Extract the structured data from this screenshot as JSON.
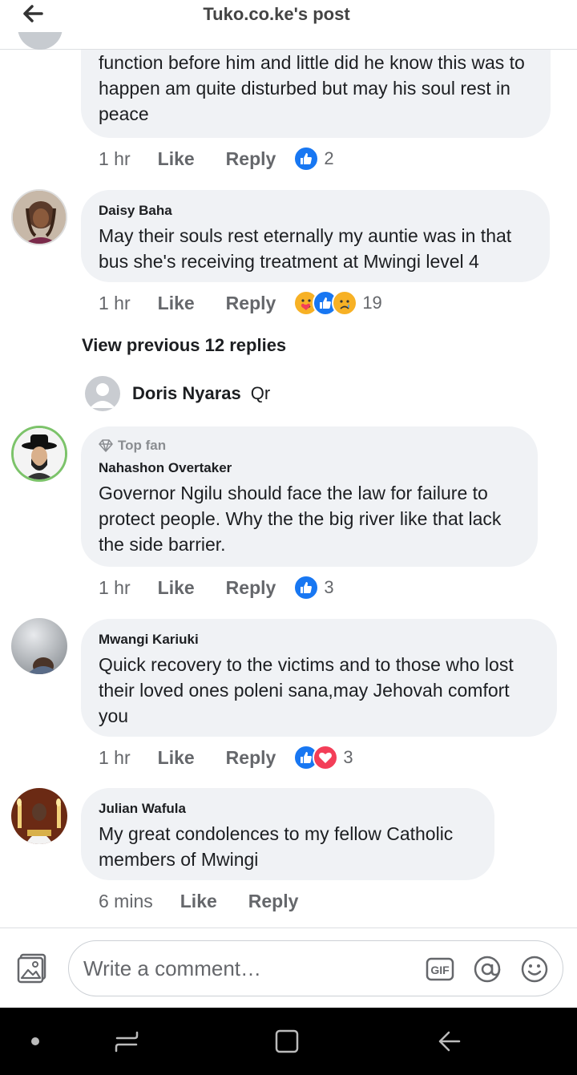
{
  "header": {
    "title": "Tuko.co.ke's post"
  },
  "comments": [
    {
      "author": "",
      "text": "function before him and little did he know this was to happen am quite disturbed but may his soul rest in peace",
      "time": "1 hr",
      "like": "Like",
      "reply": "Reply",
      "reaction_count": "2",
      "reactions": [
        "like-icon"
      ]
    },
    {
      "author": "Daisy Baha",
      "text": "May their souls rest eternally my auntie was in that bus she's receiving treatment at Mwingi level 4",
      "time": "1 hr",
      "like": "Like",
      "reply": "Reply",
      "reaction_count": "19",
      "reactions": [
        "care-icon",
        "like-icon",
        "sad-icon"
      ]
    },
    {
      "author": "Nahashon Overtaker",
      "badge": "Top fan",
      "text": "Governor Ngilu should face the law for failure to protect people. Why the the big river like that lack the side barrier.",
      "time": "1 hr",
      "like": "Like",
      "reply": "Reply",
      "reaction_count": "3",
      "reactions": [
        "like-icon"
      ]
    },
    {
      "author": "Mwangi Kariuki",
      "text": "Quick recovery to the victims and to those who lost their loved ones poleni sana,may Jehovah comfort you",
      "time": "1 hr",
      "like": "Like",
      "reply": "Reply",
      "reaction_count": "3",
      "reactions": [
        "like-icon",
        "love-icon"
      ]
    },
    {
      "author": "Julian Wafula",
      "text": "My great condolences to my fellow Catholic members of Mwingi",
      "time": "6 mins",
      "like": "Like",
      "reply": "Reply"
    }
  ],
  "view_previous": "View previous 12 replies",
  "typing": {
    "name": "Doris Nyaras",
    "text": "Qr"
  },
  "composer": {
    "placeholder": "Write a comment…",
    "icons": [
      "photo-icon",
      "gif-icon",
      "mention-icon",
      "emoji-icon"
    ]
  },
  "navbar": {
    "icons": [
      "dot-icon",
      "recents-icon",
      "home-icon",
      "back-icon"
    ]
  },
  "colors": {
    "like_blue": "#1877f2",
    "love_red": "#f33e58",
    "care_yellow": "#f7b125",
    "bubble_bg": "#f0f2f5",
    "muted": "#65676b"
  }
}
